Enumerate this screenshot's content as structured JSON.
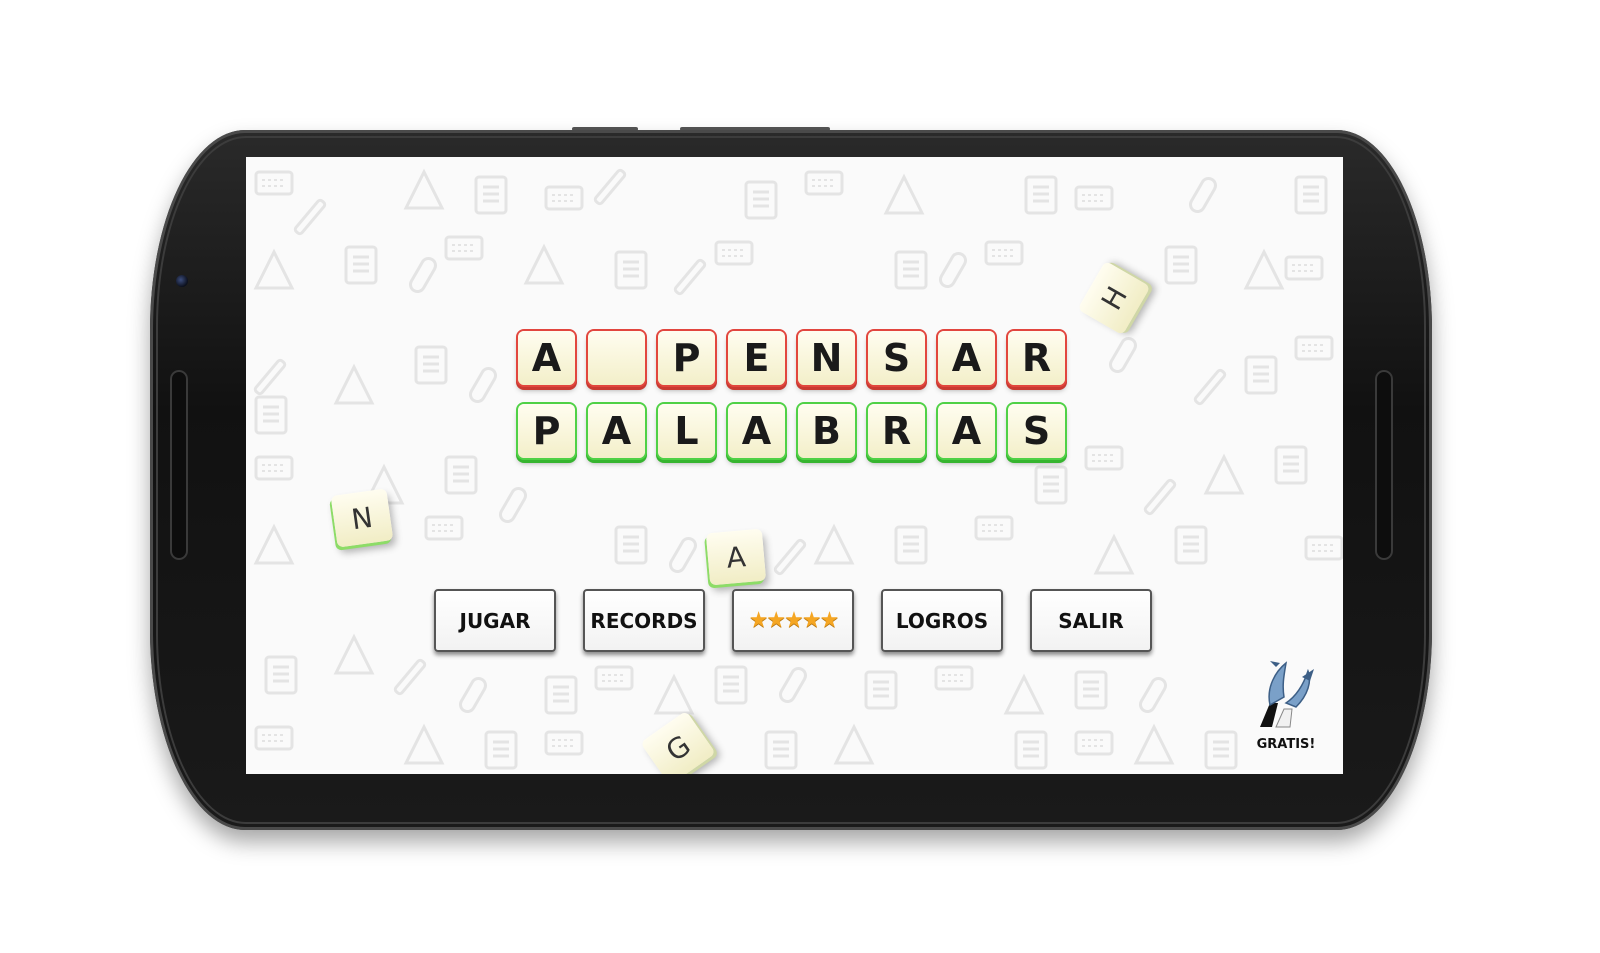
{
  "title": {
    "row1": [
      "A",
      "",
      "P",
      "E",
      "N",
      "S",
      "A",
      "R"
    ],
    "row2": [
      "P",
      "A",
      "L",
      "A",
      "B",
      "R",
      "A",
      "S"
    ]
  },
  "floating_tiles": [
    "H",
    "N",
    "A",
    "G"
  ],
  "menu": {
    "play_label": "JUGAR",
    "records_label": "RECORDS",
    "rate_stars": "★★★★★",
    "achievements_label": "LOGROS",
    "exit_label": "SALIR"
  },
  "promo": {
    "label": "GRATIS!"
  },
  "colors": {
    "row1_tile_edge": "#e2463e",
    "row2_tile_edge": "#4fd146",
    "star": "#f5a623",
    "tile_face": "#fffdf0"
  }
}
